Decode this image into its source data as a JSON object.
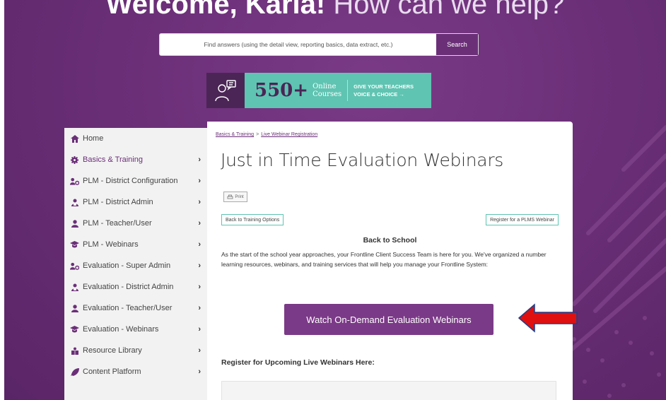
{
  "header": {
    "welcome_bold": "Welcome, Karla!",
    "welcome_light": "How can we help?"
  },
  "search": {
    "placeholder": "Find answers (using the detail view, reporting basics, data extract, etc.)",
    "button_label": "Search"
  },
  "banner": {
    "count": "550+",
    "online_line1": "Online",
    "online_line2": "Courses",
    "cta_line1": "GIVE YOUR TEACHERS",
    "cta_line2": "VOICE & CHOICE →"
  },
  "sidebar": {
    "items": [
      {
        "label": "Home",
        "icon": "home-icon",
        "chevron": ""
      },
      {
        "label": "Basics & Training",
        "icon": "gear-icon",
        "chevron": "›"
      },
      {
        "label": "PLM - District Configuration",
        "icon": "users-config-icon",
        "chevron": "›"
      },
      {
        "label": "PLM - District Admin",
        "icon": "user-admin-icon",
        "chevron": "›"
      },
      {
        "label": "PLM - Teacher/User",
        "icon": "user-icon",
        "chevron": "›"
      },
      {
        "label": "PLM - Webinars",
        "icon": "graduation-cap-icon",
        "chevron": "›"
      },
      {
        "label": "Evaluation - Super Admin",
        "icon": "users-config-icon",
        "chevron": "›"
      },
      {
        "label": "Evaluation - District Admin",
        "icon": "user-admin-icon",
        "chevron": "›"
      },
      {
        "label": "Evaluation - Teacher/User",
        "icon": "user-icon",
        "chevron": "›"
      },
      {
        "label": "Evaluation - Webinars",
        "icon": "graduation-cap-icon",
        "chevron": "›"
      },
      {
        "label": "Resource Library",
        "icon": "library-icon",
        "chevron": "›"
      },
      {
        "label": "Content Platform",
        "icon": "rocket-icon",
        "chevron": "›"
      }
    ]
  },
  "content": {
    "breadcrumb_1": "Basics & Training",
    "breadcrumb_sep": ">",
    "breadcrumb_2": "Live Webinar Registration",
    "title": "Just in Time Evaluation Webinars",
    "print_label": "Print",
    "back_btn": "Back to Training Options",
    "register_btn": "Register for a PLMS Webinar",
    "sub_heading": "Back to School",
    "paragraph": "As the start of the school year approaches, your Frontline Client Success Team is here for you. We've organized a number learning resources, webinars, and training services that will help you manage your Frontline System:",
    "cta": "Watch On-Demand Evaluation Webinars",
    "register_heading": "Register for Upcoming Live Webinars Here:"
  },
  "colors": {
    "brand_purple": "#6b2f78",
    "teal": "#5fc4b2",
    "arrow_red": "#e01010"
  }
}
